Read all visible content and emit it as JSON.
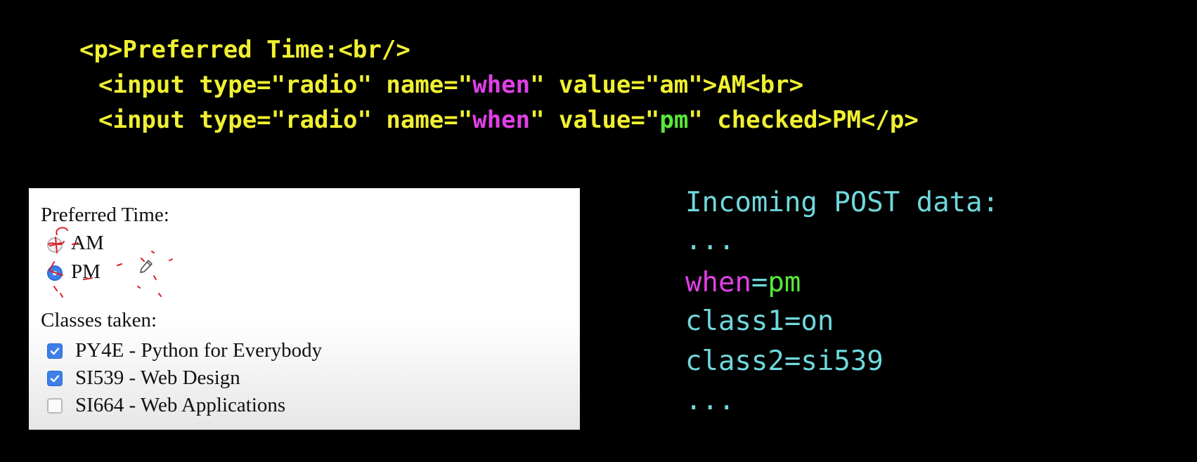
{
  "code": {
    "line1": "<p>Preferred Time:<br/>",
    "line2_a": "<input type=\"radio\" name=\"",
    "line2_name": "when",
    "line2_b": "\" value=\"am\">AM<br>",
    "line3_a": "<input type=\"radio\" name=\"",
    "line3_name": "when",
    "line3_b": "\" value=\"",
    "line3_value": "pm",
    "line3_c": "\" checked>PM</p>"
  },
  "form": {
    "preferred_label": "Preferred Time:",
    "am_label": "AM",
    "pm_label": "PM",
    "am_checked": false,
    "pm_checked": true,
    "classes_label": "Classes taken:",
    "classes": [
      {
        "label": "PY4E - Python for Everybody",
        "checked": true
      },
      {
        "label": "SI539 - Web Design",
        "checked": true
      },
      {
        "label": "SI664 - Web Applications",
        "checked": false
      }
    ]
  },
  "post": {
    "title": "Incoming POST data:",
    "ellipsis_top": "...",
    "when_key": "when",
    "when_eq": "=",
    "when_value": "pm",
    "class1": "class1=on",
    "class2": "class2=si539",
    "ellipsis_bottom": "..."
  },
  "colors": {
    "background": "#000000",
    "code_yellow": "#f0f032",
    "highlight_magenta": "#e040e8",
    "highlight_green": "#58e83a",
    "post_cyan": "#6fd8dc",
    "checkbox_blue": "#3d7fe6",
    "annotation_red": "#d8202a"
  }
}
